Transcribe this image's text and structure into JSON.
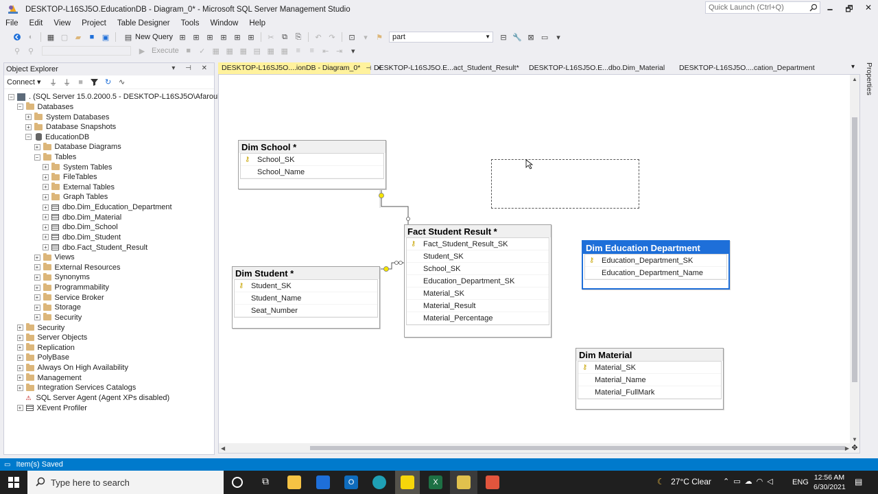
{
  "window": {
    "title": "DESKTOP-L16SJ5O.EducationDB - Diagram_0* - Microsoft SQL Server Management Studio",
    "quick_launch_placeholder": "Quick Launch (Ctrl+Q)",
    "minimize": "🗕",
    "restore": "🗗",
    "close": "✕"
  },
  "menu": [
    "File",
    "Edit",
    "View",
    "Project",
    "Table Designer",
    "Tools",
    "Window",
    "Help"
  ],
  "toolbar": {
    "new_query": "New Query",
    "search_value": "part",
    "execute": "Execute"
  },
  "object_explorer": {
    "title": "Object Explorer",
    "header_buttons": "▾ ⊣ ✕",
    "connect": "Connect ▾",
    "tree": [
      {
        "label": ". (SQL Server 15.0.2000.5 - DESKTOP-L16SJ5O\\Afarouk)",
        "level": 0,
        "exp": "−",
        "icon": "server"
      },
      {
        "label": "Databases",
        "level": 1,
        "exp": "−",
        "icon": "folder"
      },
      {
        "label": "System Databases",
        "level": 2,
        "exp": "+",
        "icon": "folder"
      },
      {
        "label": "Database Snapshots",
        "level": 2,
        "exp": "+",
        "icon": "folder"
      },
      {
        "label": "EducationDB",
        "level": 2,
        "exp": "−",
        "icon": "db"
      },
      {
        "label": "Database Diagrams",
        "level": 3,
        "exp": "+",
        "icon": "folder"
      },
      {
        "label": "Tables",
        "level": 3,
        "exp": "−",
        "icon": "folder"
      },
      {
        "label": "System Tables",
        "level": 4,
        "exp": "+",
        "icon": "folder"
      },
      {
        "label": "FileTables",
        "level": 4,
        "exp": "+",
        "icon": "folder"
      },
      {
        "label": "External Tables",
        "level": 4,
        "exp": "+",
        "icon": "folder"
      },
      {
        "label": "Graph Tables",
        "level": 4,
        "exp": "+",
        "icon": "folder"
      },
      {
        "label": "dbo.Dim_Education_Department",
        "level": 4,
        "exp": "+",
        "icon": "table"
      },
      {
        "label": "dbo.Dim_Material",
        "level": 4,
        "exp": "+",
        "icon": "table"
      },
      {
        "label": "dbo.Dim_School",
        "level": 4,
        "exp": "+",
        "icon": "table"
      },
      {
        "label": "dbo.Dim_Student",
        "level": 4,
        "exp": "+",
        "icon": "table"
      },
      {
        "label": "dbo.Fact_Student_Result",
        "level": 4,
        "exp": "+",
        "icon": "table"
      },
      {
        "label": "Views",
        "level": 3,
        "exp": "+",
        "icon": "folder"
      },
      {
        "label": "External Resources",
        "level": 3,
        "exp": "+",
        "icon": "folder"
      },
      {
        "label": "Synonyms",
        "level": 3,
        "exp": "+",
        "icon": "folder"
      },
      {
        "label": "Programmability",
        "level": 3,
        "exp": "+",
        "icon": "folder"
      },
      {
        "label": "Service Broker",
        "level": 3,
        "exp": "+",
        "icon": "folder"
      },
      {
        "label": "Storage",
        "level": 3,
        "exp": "+",
        "icon": "folder"
      },
      {
        "label": "Security",
        "level": 3,
        "exp": "+",
        "icon": "folder"
      },
      {
        "label": "Security",
        "level": 1,
        "exp": "+",
        "icon": "folder"
      },
      {
        "label": "Server Objects",
        "level": 1,
        "exp": "+",
        "icon": "folder"
      },
      {
        "label": "Replication",
        "level": 1,
        "exp": "+",
        "icon": "folder"
      },
      {
        "label": "PolyBase",
        "level": 1,
        "exp": "+",
        "icon": "folder"
      },
      {
        "label": "Always On High Availability",
        "level": 1,
        "exp": "+",
        "icon": "folder"
      },
      {
        "label": "Management",
        "level": 1,
        "exp": "+",
        "icon": "folder"
      },
      {
        "label": "Integration Services Catalogs",
        "level": 1,
        "exp": "+",
        "icon": "folder"
      },
      {
        "label": "SQL Server Agent (Agent XPs disabled)",
        "level": 1,
        "exp": "",
        "icon": "agent"
      },
      {
        "label": "XEvent Profiler",
        "level": 1,
        "exp": "+",
        "icon": "xevent"
      }
    ]
  },
  "tabs": [
    {
      "label": "DESKTOP-L16SJ5O....ionDB - Diagram_0*",
      "active": true
    },
    {
      "label": "DESKTOP-L16SJ5O.E...act_Student_Result*",
      "active": false
    },
    {
      "label": "DESKTOP-L16SJ5O.E...dbo.Dim_Material",
      "active": false
    },
    {
      "label": "DESKTOP-L16SJ5O....cation_Department",
      "active": false
    }
  ],
  "tab_pin": "⊣",
  "tab_close": "✕",
  "properties_label": "Properties",
  "diagram": {
    "tables": [
      {
        "name": "Dim School *",
        "columns": [
          {
            "name": "School_SK",
            "key": true
          },
          {
            "name": "School_Name",
            "key": false
          }
        ],
        "selected": false
      },
      {
        "name": "Fact Student Result *",
        "columns": [
          {
            "name": "Fact_Student_Result_SK",
            "key": true
          },
          {
            "name": "Student_SK",
            "key": false
          },
          {
            "name": "School_SK",
            "key": false
          },
          {
            "name": "Education_Department_SK",
            "key": false
          },
          {
            "name": "Material_SK",
            "key": false
          },
          {
            "name": "Material_Result",
            "key": false
          },
          {
            "name": "Material_Percentage",
            "key": false
          }
        ],
        "selected": false
      },
      {
        "name": "Dim Student *",
        "columns": [
          {
            "name": "Student_SK",
            "key": true
          },
          {
            "name": "Student_Name",
            "key": false
          },
          {
            "name": "Seat_Number",
            "key": false
          }
        ],
        "selected": false
      },
      {
        "name": "Dim Education Department",
        "columns": [
          {
            "name": "Education_Department_SK",
            "key": true
          },
          {
            "name": "Education_Department_Name",
            "key": false
          }
        ],
        "selected": true
      },
      {
        "name": "Dim Material",
        "columns": [
          {
            "name": "Material_SK",
            "key": true
          },
          {
            "name": "Material_Name",
            "key": false
          },
          {
            "name": "Material_FullMark",
            "key": false
          }
        ],
        "selected": false
      }
    ]
  },
  "status": {
    "text": "Item(s) Saved"
  },
  "taskbar": {
    "search_placeholder": "Type here to search",
    "weather": "27°C  Clear",
    "language": "ENG",
    "time": "12:56 AM",
    "date": "6/30/2021"
  }
}
